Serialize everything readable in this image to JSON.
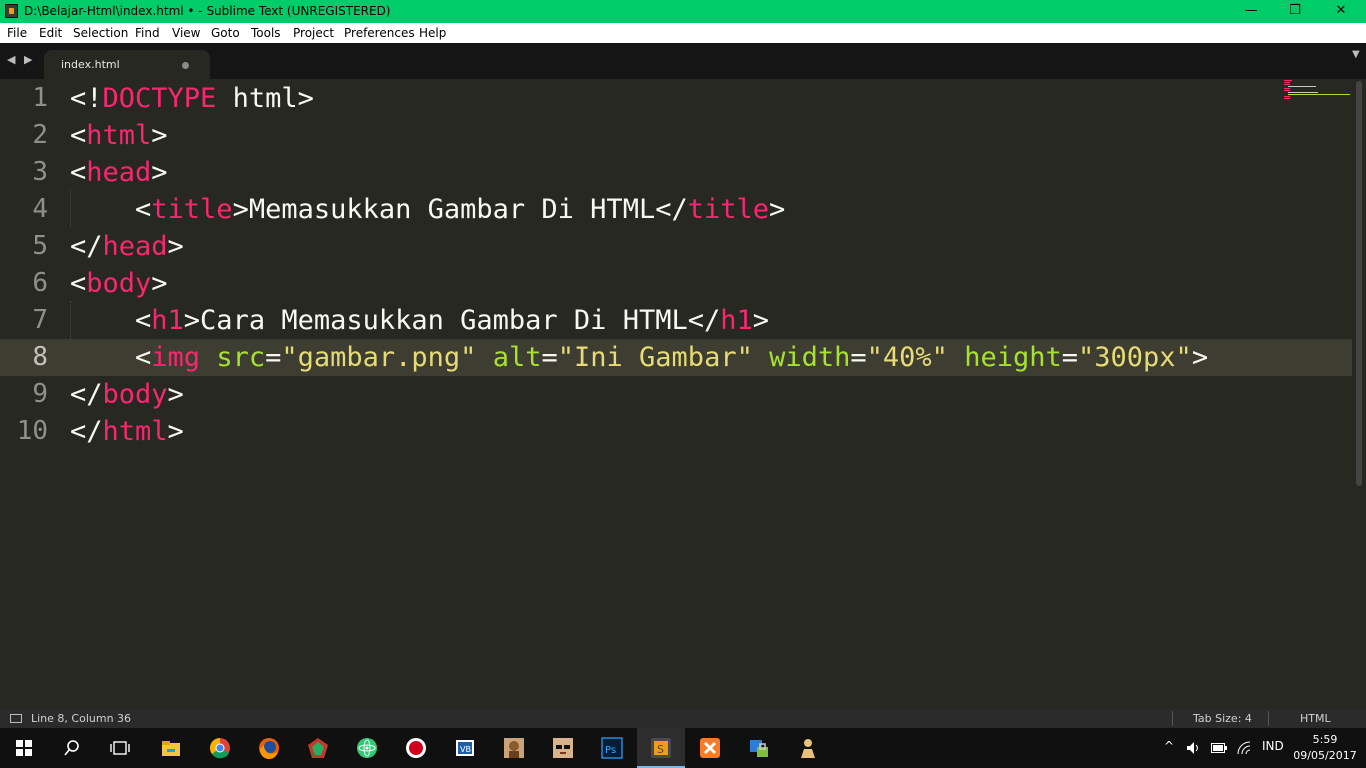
{
  "window": {
    "title": "D:\\Belajar-Html\\index.html • - Sublime Text (UNREGISTERED)",
    "minimize": "—",
    "restore": "❐",
    "close": "✕"
  },
  "menu": [
    "File",
    "Edit",
    "Selection",
    "Find",
    "View",
    "Goto",
    "Tools",
    "Project",
    "Preferences",
    "Help"
  ],
  "tabs": {
    "prev_icon": "◀",
    "next_icon": "▶",
    "active_tab": "index.html",
    "dropdown_icon": "▼"
  },
  "editor": {
    "current_line": 8,
    "lines": [
      {
        "num": "1",
        "tokens": [
          [
            "p",
            "<!"
          ],
          [
            "t",
            "DOCTYPE"
          ],
          [
            "p",
            " html>"
          ]
        ]
      },
      {
        "num": "2",
        "tokens": [
          [
            "p",
            "<"
          ],
          [
            "t",
            "html"
          ],
          [
            "p",
            ">"
          ]
        ]
      },
      {
        "num": "3",
        "tokens": [
          [
            "p",
            "<"
          ],
          [
            "t",
            "head"
          ],
          [
            "p",
            ">"
          ]
        ]
      },
      {
        "num": "4",
        "tokens": [
          [
            "p",
            "    <"
          ],
          [
            "t",
            "title"
          ],
          [
            "p",
            ">Memasukkan Gambar Di HTML</"
          ],
          [
            "t",
            "title"
          ],
          [
            "p",
            ">"
          ]
        ]
      },
      {
        "num": "5",
        "tokens": [
          [
            "p",
            "</"
          ],
          [
            "t",
            "head"
          ],
          [
            "p",
            ">"
          ]
        ]
      },
      {
        "num": "6",
        "tokens": [
          [
            "p",
            "<"
          ],
          [
            "t",
            "body"
          ],
          [
            "p",
            ">"
          ]
        ]
      },
      {
        "num": "7",
        "tokens": [
          [
            "p",
            "    <"
          ],
          [
            "t",
            "h1"
          ],
          [
            "p",
            ">Cara Memasukkan Gambar Di HTML</"
          ],
          [
            "t",
            "h1"
          ],
          [
            "p",
            ">"
          ]
        ]
      },
      {
        "num": "8",
        "tokens": [
          [
            "p",
            "    <"
          ],
          [
            "t",
            "img"
          ],
          [
            "p",
            " "
          ],
          [
            "a",
            "src"
          ],
          [
            "p",
            "="
          ],
          [
            "s",
            "\"gambar.png\""
          ],
          [
            "p",
            " "
          ],
          [
            "a",
            "alt"
          ],
          [
            "p",
            "="
          ],
          [
            "s",
            "\"Ini Gambar\""
          ],
          [
            "p",
            " "
          ],
          [
            "a",
            "width"
          ],
          [
            "p",
            "="
          ],
          [
            "s",
            "\"40%\""
          ],
          [
            "p",
            " "
          ],
          [
            "a",
            "height"
          ],
          [
            "p",
            "="
          ],
          [
            "s",
            "\"300px\""
          ],
          [
            "p",
            ">"
          ]
        ]
      },
      {
        "num": "9",
        "tokens": [
          [
            "p",
            "</"
          ],
          [
            "t",
            "body"
          ],
          [
            "p",
            ">"
          ]
        ]
      },
      {
        "num": "10",
        "tokens": [
          [
            "p",
            "</"
          ],
          [
            "t",
            "html"
          ],
          [
            "p",
            ">"
          ]
        ]
      }
    ],
    "colors": {
      "p": "#f8f8f2",
      "t": "#f92672",
      "a": "#a6e22e",
      "s": "#e6db74"
    }
  },
  "status": {
    "position": "Line 8, Column 36",
    "tab_size": "Tab Size: 4",
    "syntax": "HTML"
  },
  "taskbar": {
    "apps": [
      "start-icon",
      "search-icon",
      "task-view-icon",
      "file-explorer-icon",
      "chrome-icon",
      "firefox-icon",
      "app-icon-red",
      "atom-icon",
      "recorder-icon",
      "virtualbox-icon",
      "app-icon-avatar",
      "app-icon-glasses",
      "photoshop-icon",
      "sublime-text-icon",
      "xampp-icon",
      "app-icon-lock",
      "app-icon-person"
    ],
    "tray": {
      "chevron": "^",
      "language": "IND",
      "time": "5:59",
      "date": "09/05/2017"
    }
  }
}
